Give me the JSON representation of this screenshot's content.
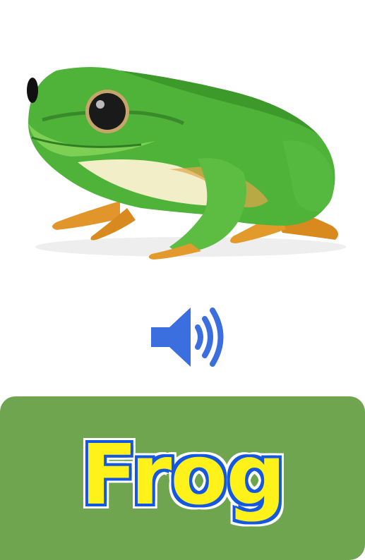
{
  "card": {
    "word": "Frog",
    "image_icon": "frog-illustration",
    "sound_icon": "speaker-icon"
  },
  "colors": {
    "panel": "#6fa54e",
    "word_fill": "#fff21a",
    "word_outline": "#1458e0",
    "speaker": "#3b6fe0"
  }
}
